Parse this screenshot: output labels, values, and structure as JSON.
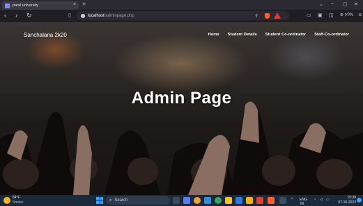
{
  "browser": {
    "tab_title": "parul university",
    "tab_close": "×",
    "new_tab": "+",
    "window_controls": [
      "⌄",
      "–",
      "▢",
      "✕"
    ],
    "nav_buttons": [
      "‹",
      "›",
      "↻"
    ],
    "bookmark_icon": "bookmark-icon",
    "url_host": "localhost",
    "url_path": "/adminpage.php",
    "vpn_label": "⊕ VPN",
    "menu_icon": "≡"
  },
  "site": {
    "brand": "Sanchalana 2k20",
    "nav": [
      "Home",
      "Student Details",
      "Student Co-ordinator",
      "Staff-Co-ordinator"
    ],
    "hero_title": "Admin Page"
  },
  "taskbar": {
    "weather_temp": "84°F",
    "weather_desc": "Smoke",
    "search_placeholder": "Search",
    "tray_lang": "ENG",
    "tray_region": "IN",
    "time": "15:39",
    "date": "07-10-2023"
  },
  "colors": {
    "accent": "#3aa0ff",
    "brave_shield": "#ff5f2e"
  }
}
